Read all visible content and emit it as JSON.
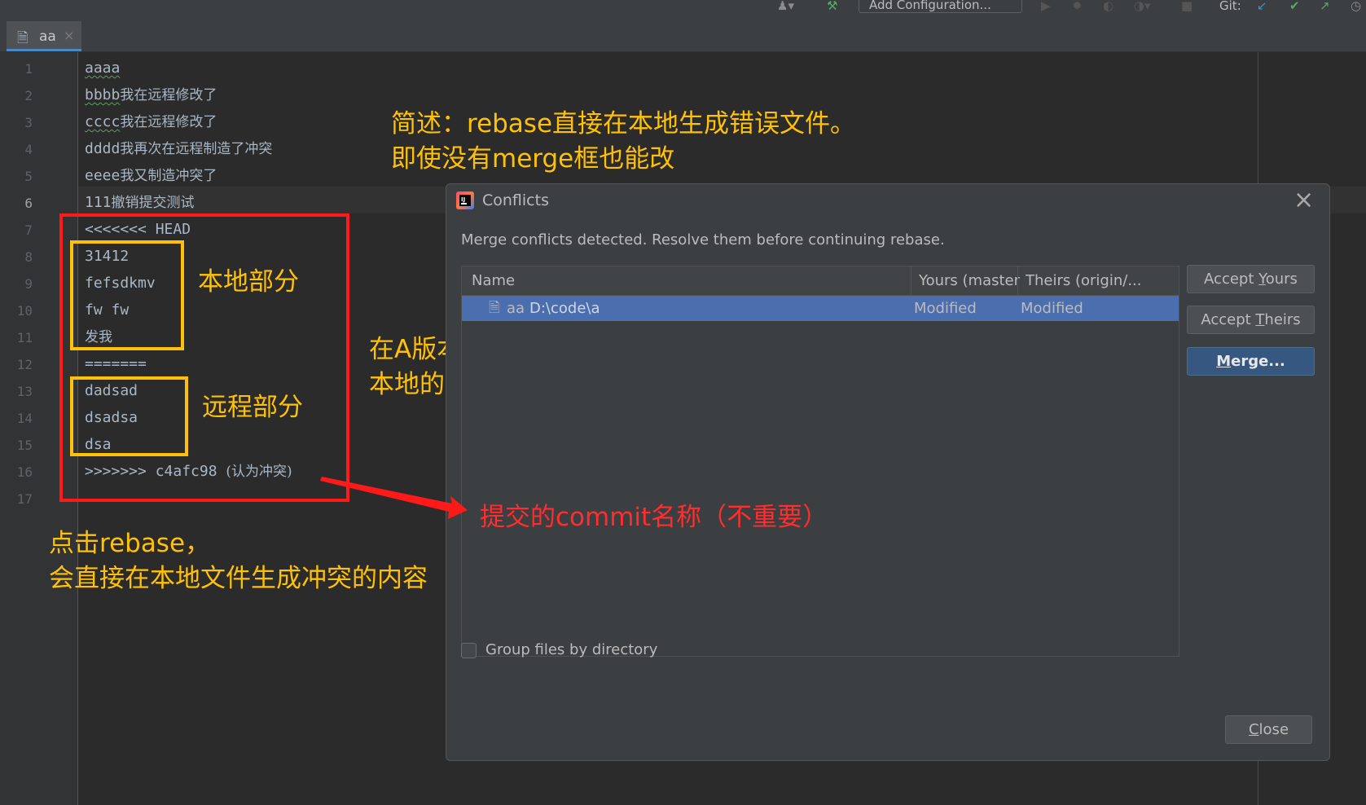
{
  "toolbar": {
    "add_configuration": "Add Configuration...",
    "git_label": "Git:"
  },
  "tab": {
    "name": "aa",
    "close": "×"
  },
  "editor": {
    "current_line": 6,
    "lines": [
      {
        "n": "1",
        "text": "aaaa"
      },
      {
        "n": "2",
        "text": "bbbb",
        "cn": "我在远程修改了"
      },
      {
        "n": "3",
        "text": "cccc",
        "cn": "我在远程修改了"
      },
      {
        "n": "4",
        "text": "dddd",
        "cn": "我再次在远程制造了冲突"
      },
      {
        "n": "5",
        "text": "eeee",
        "cn": "我又制造冲突了"
      },
      {
        "n": "6",
        "text": "111",
        "cn": "撤销提交测试"
      },
      {
        "n": "7",
        "text": "<<<<<<< HEAD"
      },
      {
        "n": "8",
        "text": "31412"
      },
      {
        "n": "9",
        "text": "fefsdkmv"
      },
      {
        "n": "10",
        "text": "fw fw"
      },
      {
        "n": "11",
        "text": "",
        "cn": "发我"
      },
      {
        "n": "12",
        "text": "======="
      },
      {
        "n": "13",
        "text": "dadsad"
      },
      {
        "n": "14",
        "text": "dsadsa"
      },
      {
        "n": "15",
        "text": "dsa"
      },
      {
        "n": "16",
        "text": ">>>>>>> c4afc98 ",
        "cn": "(认为冲突)"
      },
      {
        "n": "17",
        "text": ""
      }
    ]
  },
  "annotations": {
    "summary_line1": "简述：rebase直接在本地生成错误文件。",
    "summary_line2": "即使没有merge框也能改",
    "local_part": "本地部分",
    "remote_part": "远程部分",
    "diff_line1": "在A版本的基础上，",
    "diff_line2": "本地的内容，跟远程的内容有区别",
    "commit_note": "提交的commit名称（不重要）",
    "rebase_line1": "点击rebase，",
    "rebase_line2": "会直接在本地文件生成冲突的内容",
    "colors": {
      "yellow": "#ffc107",
      "red": "#ff2d2d"
    }
  },
  "dialog": {
    "title": "Conflicts",
    "message": "Merge conflicts detected. Resolve them before continuing rebase.",
    "columns": {
      "name": "Name",
      "yours": "Yours (master)",
      "theirs": "Theirs (origin/..."
    },
    "rows": [
      {
        "name": "aa",
        "path": "D:\\code\\a",
        "yours": "Modified",
        "theirs": "Modified"
      }
    ],
    "buttons": {
      "accept_yours": {
        "pre": "Accept ",
        "key": "Y",
        "post": "ours"
      },
      "accept_theirs": {
        "pre": "Accept ",
        "key": "T",
        "post": "heirs"
      },
      "merge": {
        "pre": "",
        "key": "M",
        "post": "erge..."
      },
      "close": {
        "pre": "",
        "key": "C",
        "post": "lose"
      }
    },
    "group_files": "Group files by directory",
    "selection_color": "#4b6eaf"
  }
}
